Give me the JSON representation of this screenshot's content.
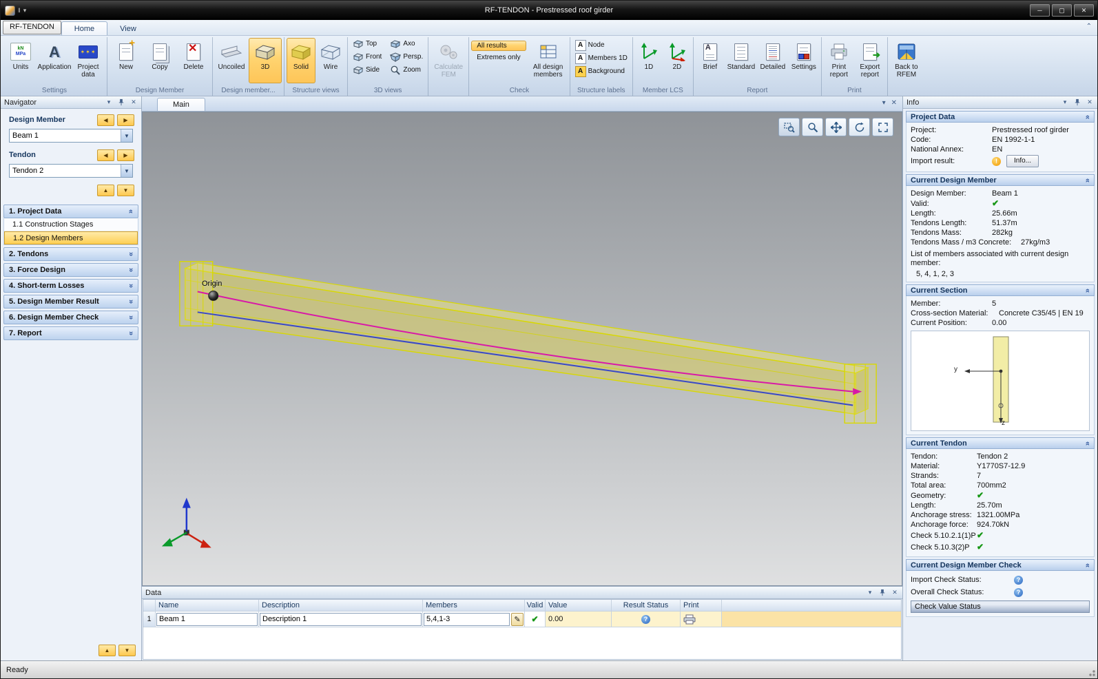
{
  "window": {
    "title": "RF-TENDON - Prestressed roof girder",
    "status": "Ready"
  },
  "tabs": {
    "app_button": "RF-TENDON",
    "home": "Home",
    "view": "View"
  },
  "ribbon": {
    "groups": [
      {
        "caption": "Settings",
        "buttons": [
          {
            "label": "Units"
          },
          {
            "label": "Application"
          },
          {
            "label": "Project data"
          }
        ]
      },
      {
        "caption": "Design Member",
        "buttons": [
          {
            "label": "New"
          },
          {
            "label": "Copy"
          },
          {
            "label": "Delete"
          }
        ]
      },
      {
        "caption": "Design member...",
        "buttons": [
          {
            "label": "Uncoiled"
          },
          {
            "label": "3D"
          }
        ]
      },
      {
        "caption": "Structure views",
        "buttons": [
          {
            "label": "Solid"
          },
          {
            "label": "Wire"
          }
        ]
      },
      {
        "caption": "3D views",
        "buttons": [
          {
            "label": "Top"
          },
          {
            "label": "Front"
          },
          {
            "label": "Side"
          },
          {
            "label": "Axo"
          },
          {
            "label": "Persp."
          },
          {
            "label": "Zoom"
          }
        ]
      },
      {
        "caption": "",
        "buttons": [
          {
            "label": "Calculate FEM"
          }
        ]
      },
      {
        "caption": "Check",
        "buttons": [
          {
            "label": "All results"
          },
          {
            "label": "Extremes only"
          },
          {
            "label": "All design members"
          }
        ]
      },
      {
        "caption": "Structure labels",
        "buttons": [
          {
            "label": "Node"
          },
          {
            "label": "Members 1D"
          },
          {
            "label": "Background"
          }
        ]
      },
      {
        "caption": "Member LCS",
        "buttons": [
          {
            "label": "1D"
          },
          {
            "label": "2D"
          }
        ]
      },
      {
        "caption": "Report",
        "buttons": [
          {
            "label": "Brief"
          },
          {
            "label": "Standard"
          },
          {
            "label": "Detailed"
          },
          {
            "label": "Settings"
          }
        ]
      },
      {
        "caption": "Print",
        "buttons": [
          {
            "label": "Print report"
          },
          {
            "label": "Export report"
          }
        ]
      },
      {
        "caption": "",
        "buttons": [
          {
            "label": "Back to RFEM"
          }
        ]
      }
    ]
  },
  "navigator": {
    "title": "Navigator",
    "design_member_label": "Design Member",
    "design_member_value": "Beam 1",
    "tendon_label": "Tendon",
    "tendon_value": "Tendon 2",
    "sections": [
      {
        "label": "1. Project Data"
      },
      {
        "label": "1.1 Construction Stages"
      },
      {
        "label": "1.2 Design Members"
      },
      {
        "label": "2. Tendons"
      },
      {
        "label": "3. Force Design"
      },
      {
        "label": "4. Short-term Losses"
      },
      {
        "label": "5. Design Member Result"
      },
      {
        "label": "6. Design Member Check"
      },
      {
        "label": "7. Report"
      }
    ]
  },
  "main": {
    "tab": "Main",
    "origin_label": "Origin"
  },
  "data_panel": {
    "title": "Data",
    "columns": [
      "Name",
      "Description",
      "Members",
      "Valid",
      "Value",
      "Result Status",
      "Print"
    ],
    "row": {
      "index": "1",
      "name": "Beam 1",
      "description": "Description 1",
      "members": "5,4,1-3",
      "value": "0.00"
    }
  },
  "info": {
    "title": "Info",
    "project_data": {
      "header": "Project Data",
      "rows": [
        {
          "label": "Project:",
          "value": "Prestressed roof girder"
        },
        {
          "label": "Code:",
          "value": "EN 1992-1-1"
        },
        {
          "label": "National Annex:",
          "value": "EN"
        },
        {
          "label": "Import result:",
          "value": ""
        }
      ],
      "info_button": "Info..."
    },
    "current_design_member": {
      "header": "Current Design Member",
      "rows": [
        {
          "label": "Design Member:",
          "value": "Beam 1"
        },
        {
          "label": "Valid:",
          "value": ""
        },
        {
          "label": "Length:",
          "value": "25.66m"
        },
        {
          "label": "Tendons Length:",
          "value": "51.37m"
        },
        {
          "label": "Tendons Mass:",
          "value": "282kg"
        },
        {
          "label": "Tendons Mass / m3 Concrete:",
          "value": "27kg/m3"
        }
      ],
      "members_list_label": "List of members associated with current design member:",
      "members_list": "5, 4, 1, 2, 3"
    },
    "current_section": {
      "header": "Current Section",
      "rows": [
        {
          "label": "Member:",
          "value": "5"
        },
        {
          "label": "Cross-section Material:",
          "value": "Concrete C35/45 | EN 19"
        },
        {
          "label": "Current Position:",
          "value": "0.00"
        }
      ],
      "axis_y": "y",
      "axis_z": "z"
    },
    "current_tendon": {
      "header": "Current Tendon",
      "rows": [
        {
          "label": "Tendon:",
          "value": "Tendon 2"
        },
        {
          "label": "Material:",
          "value": "Y1770S7-12.9"
        },
        {
          "label": "Strands:",
          "value": "7"
        },
        {
          "label": "Total area:",
          "value": "700mm2"
        },
        {
          "label": "Geometry:",
          "value": ""
        },
        {
          "label": "Length:",
          "value": "25.70m"
        },
        {
          "label": "Anchorage stress:",
          "value": "1321.00MPa"
        },
        {
          "label": "Anchorage force:",
          "value": "924.70kN"
        },
        {
          "label": "Check 5.10.2.1(1)P",
          "value": ""
        },
        {
          "label": "Check 5.10.3(2)P",
          "value": ""
        }
      ]
    },
    "member_check": {
      "header": "Current Design Member Check",
      "rows": [
        {
          "label": "Import Check Status:"
        },
        {
          "label": "Overall Check Status:"
        },
        {
          "label": "Check Value Status"
        }
      ]
    }
  }
}
